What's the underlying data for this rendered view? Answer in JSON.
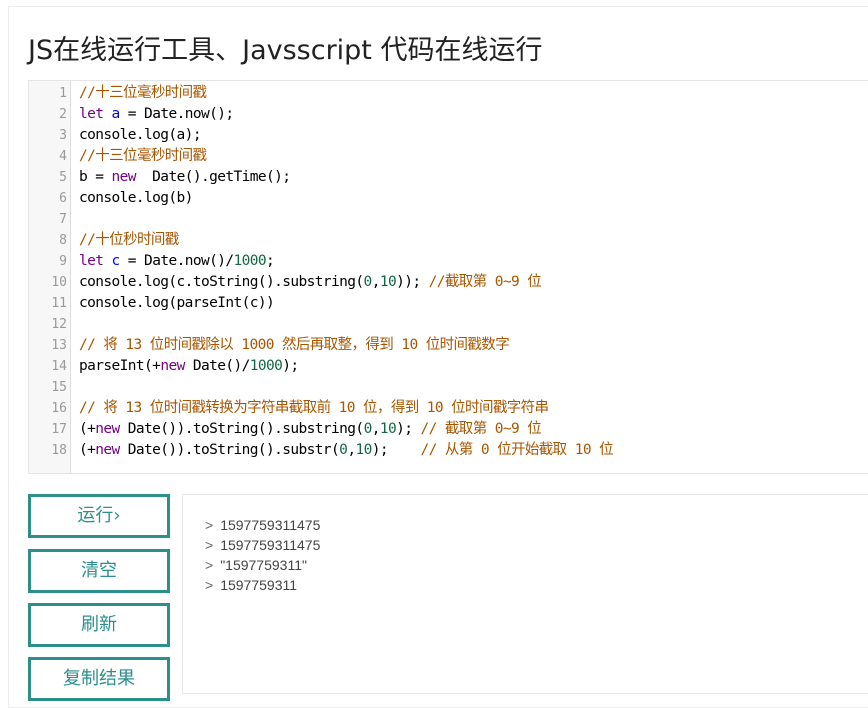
{
  "page": {
    "title": "JS在线运行工具、Javsscript 代码在线运行"
  },
  "editor": {
    "lines": [
      {
        "num": "1",
        "tokens": [
          {
            "t": "//十三位毫秒时间戳",
            "c": "comment"
          }
        ]
      },
      {
        "num": "2",
        "tokens": [
          {
            "t": "let",
            "c": "keyword"
          },
          {
            "t": " ",
            "c": "plain"
          },
          {
            "t": "a",
            "c": "def"
          },
          {
            "t": " = Date.now();",
            "c": "plain"
          }
        ]
      },
      {
        "num": "3",
        "tokens": [
          {
            "t": "console.log(a);",
            "c": "plain"
          }
        ]
      },
      {
        "num": "4",
        "tokens": [
          {
            "t": "//十三位毫秒时间戳",
            "c": "comment"
          }
        ]
      },
      {
        "num": "5",
        "tokens": [
          {
            "t": "b = ",
            "c": "plain"
          },
          {
            "t": "new",
            "c": "keyword"
          },
          {
            "t": "  Date().getTime();",
            "c": "plain"
          }
        ]
      },
      {
        "num": "6",
        "tokens": [
          {
            "t": "console.log(b)",
            "c": "plain"
          }
        ]
      },
      {
        "num": "7",
        "tokens": []
      },
      {
        "num": "8",
        "tokens": [
          {
            "t": "//十位秒时间戳",
            "c": "comment"
          }
        ]
      },
      {
        "num": "9",
        "tokens": [
          {
            "t": "let",
            "c": "keyword"
          },
          {
            "t": " ",
            "c": "plain"
          },
          {
            "t": "c",
            "c": "def"
          },
          {
            "t": " = Date.now()/",
            "c": "plain"
          },
          {
            "t": "1000",
            "c": "number"
          },
          {
            "t": ";",
            "c": "plain"
          }
        ]
      },
      {
        "num": "10",
        "tokens": [
          {
            "t": "console.log(c.toString().substring(",
            "c": "plain"
          },
          {
            "t": "0",
            "c": "number"
          },
          {
            "t": ",",
            "c": "plain"
          },
          {
            "t": "10",
            "c": "number"
          },
          {
            "t": ")); ",
            "c": "plain"
          },
          {
            "t": "//截取第 0~9 位",
            "c": "comment"
          }
        ]
      },
      {
        "num": "11",
        "tokens": [
          {
            "t": "console.log(parseInt(c))",
            "c": "plain"
          }
        ]
      },
      {
        "num": "12",
        "tokens": []
      },
      {
        "num": "13",
        "tokens": [
          {
            "t": "// 将 13 位时间戳除以 1000 然后再取整，得到 10 位时间戳数字",
            "c": "comment"
          }
        ]
      },
      {
        "num": "14",
        "tokens": [
          {
            "t": "parseInt(+",
            "c": "plain"
          },
          {
            "t": "new",
            "c": "keyword"
          },
          {
            "t": " Date()/",
            "c": "plain"
          },
          {
            "t": "1000",
            "c": "number"
          },
          {
            "t": ");",
            "c": "plain"
          }
        ]
      },
      {
        "num": "15",
        "tokens": []
      },
      {
        "num": "16",
        "tokens": [
          {
            "t": "// 将 13 位时间戳转换为字符串截取前 10 位，得到 10 位时间戳字符串",
            "c": "comment"
          }
        ]
      },
      {
        "num": "17",
        "tokens": [
          {
            "t": "(+",
            "c": "plain"
          },
          {
            "t": "new",
            "c": "keyword"
          },
          {
            "t": " Date()).toString().substring(",
            "c": "plain"
          },
          {
            "t": "0",
            "c": "number"
          },
          {
            "t": ",",
            "c": "plain"
          },
          {
            "t": "10",
            "c": "number"
          },
          {
            "t": "); ",
            "c": "plain"
          },
          {
            "t": "// 截取第 0~9 位",
            "c": "comment"
          }
        ]
      },
      {
        "num": "18",
        "tokens": [
          {
            "t": "(+",
            "c": "plain"
          },
          {
            "t": "new",
            "c": "keyword"
          },
          {
            "t": " Date()).toString().substr(",
            "c": "plain"
          },
          {
            "t": "0",
            "c": "number"
          },
          {
            "t": ",",
            "c": "plain"
          },
          {
            "t": "10",
            "c": "number"
          },
          {
            "t": ");    ",
            "c": "plain"
          },
          {
            "t": "// 从第 0 位开始截取 10 位",
            "c": "comment"
          }
        ]
      }
    ]
  },
  "buttons": {
    "run_label": "运行›",
    "clear_label": "清空",
    "refresh_label": "刷新",
    "copy_label": "复制结果"
  },
  "output": {
    "prompt": ">",
    "lines": [
      "1597759311475",
      "1597759311475",
      "\"1597759311\"",
      "1597759311"
    ]
  },
  "colors": {
    "accent": "#2b8f8c",
    "comment": "#aa5500",
    "keyword": "#770088",
    "variable": "#0000ff",
    "number": "#116644"
  }
}
